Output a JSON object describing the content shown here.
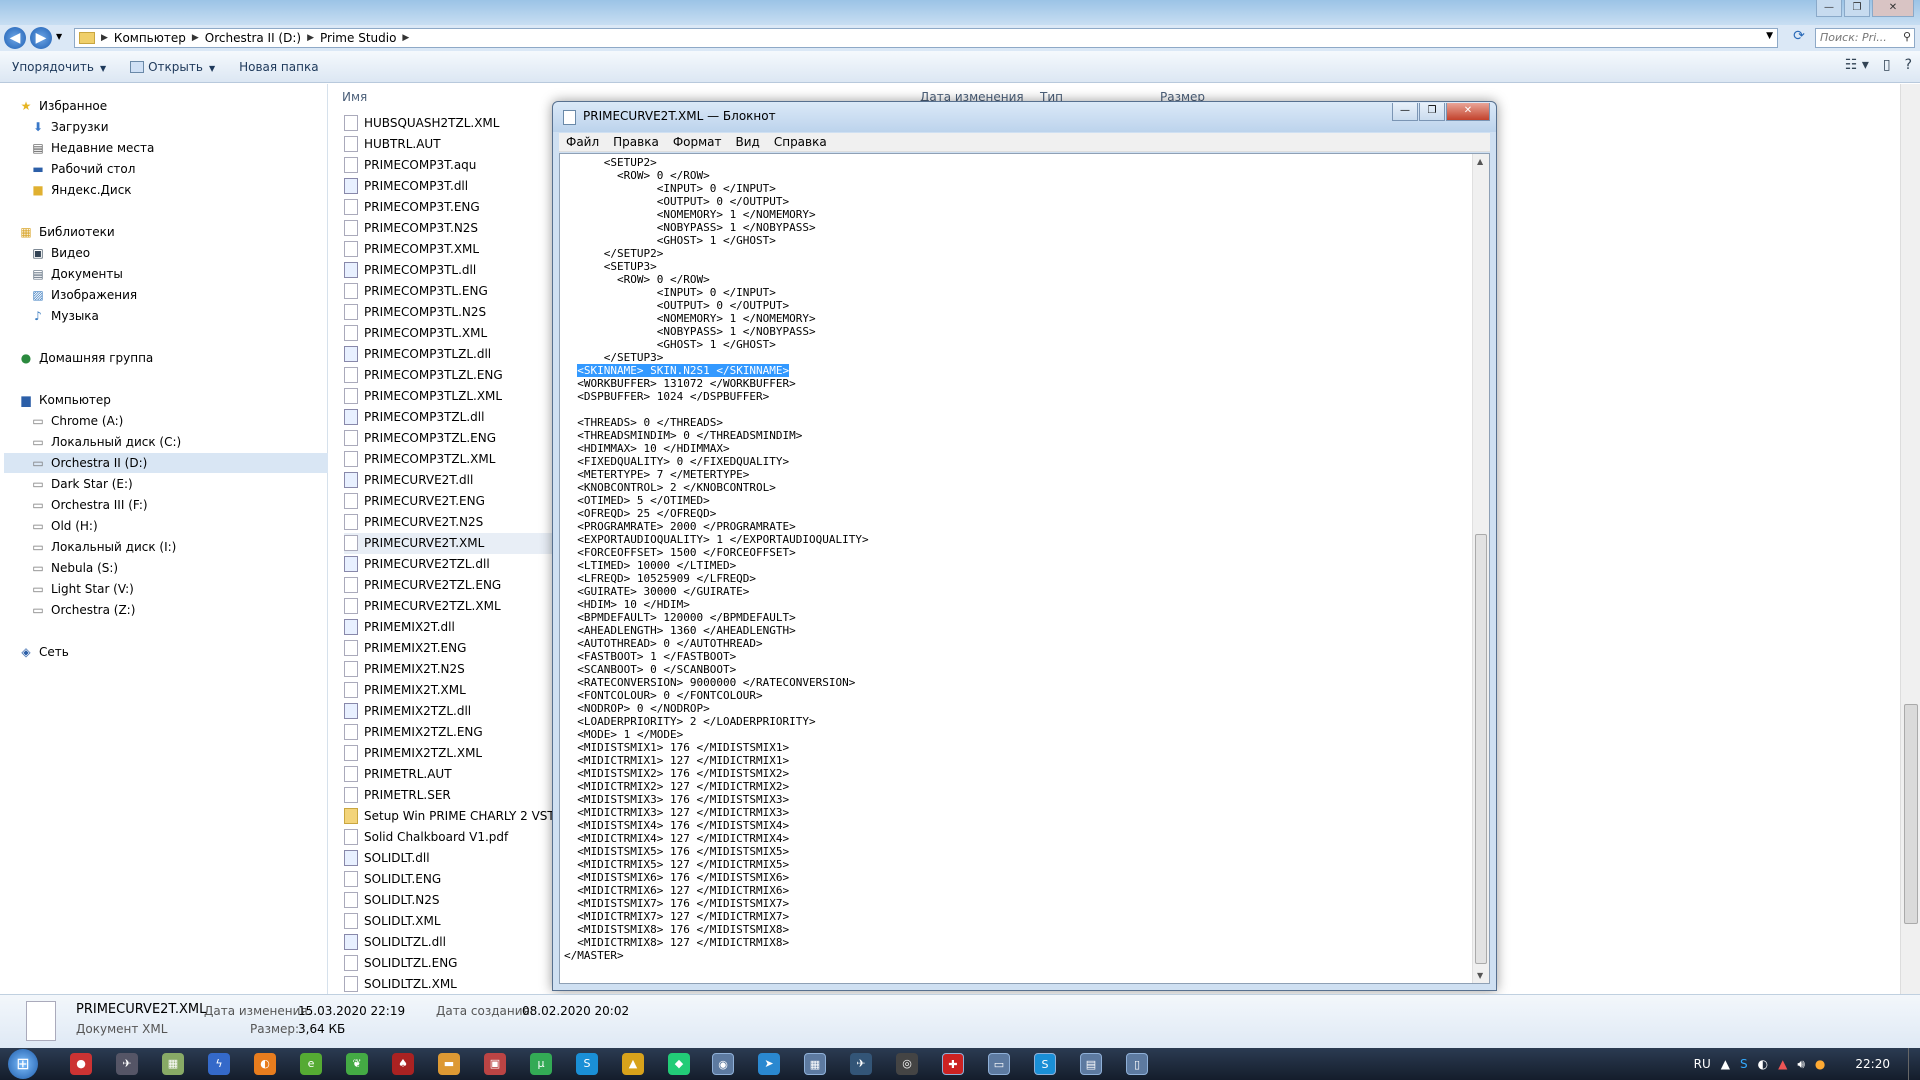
{
  "explorer": {
    "breadcrumb": [
      "Компьютер",
      "Orchestra II (D:)",
      "Prime Studio"
    ],
    "search_placeholder": "Поиск: Pri...",
    "toolbar": {
      "organize": "Упорядочить",
      "open": "Открыть",
      "new_folder": "Новая папка"
    },
    "columns": {
      "name": "Имя",
      "date": "Дата изменения",
      "type": "Тип",
      "size": "Размер"
    },
    "nav": {
      "favorites": "Избранное",
      "favorites_items": [
        "Загрузки",
        "Недавние места",
        "Рабочий стол",
        "Яндекс.Диск"
      ],
      "libraries": "Библиотеки",
      "libraries_items": [
        "Видео",
        "Документы",
        "Изображения",
        "Музыка"
      ],
      "homegroup": "Домашняя группа",
      "computer": "Компьютер",
      "computer_items": [
        "Chrome (A:)",
        "Локальный диск (C:)",
        "Orchestra II (D:)",
        "Dark Star (E:)",
        "Orchestra III (F:)",
        "Old (H:)",
        "Локальный диск (I:)",
        "Nebula (S:)",
        "Light Star (V:)",
        "Orchestra (Z:)"
      ],
      "network": "Сеть"
    },
    "files": [
      {
        "name": "HUBSQUASH2TZL.XML",
        "kind": "file"
      },
      {
        "name": "HUBTRL.AUT",
        "kind": "file"
      },
      {
        "name": "PRIMECOMP3T.aqu",
        "kind": "file"
      },
      {
        "name": "PRIMECOMP3T.dll",
        "kind": "dll"
      },
      {
        "name": "PRIMECOMP3T.ENG",
        "kind": "file"
      },
      {
        "name": "PRIMECOMP3T.N2S",
        "kind": "file"
      },
      {
        "name": "PRIMECOMP3T.XML",
        "kind": "file"
      },
      {
        "name": "PRIMECOMP3TL.dll",
        "kind": "dll"
      },
      {
        "name": "PRIMECOMP3TL.ENG",
        "kind": "file"
      },
      {
        "name": "PRIMECOMP3TL.N2S",
        "kind": "file"
      },
      {
        "name": "PRIMECOMP3TL.XML",
        "kind": "file"
      },
      {
        "name": "PRIMECOMP3TLZL.dll",
        "kind": "dll"
      },
      {
        "name": "PRIMECOMP3TLZL.ENG",
        "kind": "file"
      },
      {
        "name": "PRIMECOMP3TLZL.XML",
        "kind": "file"
      },
      {
        "name": "PRIMECOMP3TZL.dll",
        "kind": "dll"
      },
      {
        "name": "PRIMECOMP3TZL.ENG",
        "kind": "file"
      },
      {
        "name": "PRIMECOMP3TZL.XML",
        "kind": "file"
      },
      {
        "name": "PRIMECURVE2T.dll",
        "kind": "dll"
      },
      {
        "name": "PRIMECURVE2T.ENG",
        "kind": "file"
      },
      {
        "name": "PRIMECURVE2T.N2S",
        "kind": "file"
      },
      {
        "name": "PRIMECURVE2T.XML",
        "kind": "file"
      },
      {
        "name": "PRIMECURVE2TZL.dll",
        "kind": "dll"
      },
      {
        "name": "PRIMECURVE2TZL.ENG",
        "kind": "file"
      },
      {
        "name": "PRIMECURVE2TZL.XML",
        "kind": "file"
      },
      {
        "name": "PRIMEMIX2T.dll",
        "kind": "dll"
      },
      {
        "name": "PRIMEMIX2T.ENG",
        "kind": "file"
      },
      {
        "name": "PRIMEMIX2T.N2S",
        "kind": "file"
      },
      {
        "name": "PRIMEMIX2T.XML",
        "kind": "file"
      },
      {
        "name": "PRIMEMIX2TZL.dll",
        "kind": "dll"
      },
      {
        "name": "PRIMEMIX2TZL.ENG",
        "kind": "file"
      },
      {
        "name": "PRIMEMIX2TZL.XML",
        "kind": "file"
      },
      {
        "name": "PRIMETRL.AUT",
        "kind": "file"
      },
      {
        "name": "PRIMETRL.SER",
        "kind": "file"
      },
      {
        "name": "Setup Win PRIME CHARLY 2 VST 1_4",
        "kind": "folder"
      },
      {
        "name": "Solid Chalkboard V1.pdf",
        "kind": "file"
      },
      {
        "name": "SOLIDLT.dll",
        "kind": "dll"
      },
      {
        "name": "SOLIDLT.ENG",
        "kind": "file"
      },
      {
        "name": "SOLIDLT.N2S",
        "kind": "file"
      },
      {
        "name": "SOLIDLT.XML",
        "kind": "file"
      },
      {
        "name": "SOLIDLTZL.dll",
        "kind": "dll"
      },
      {
        "name": "SOLIDLTZL.ENG",
        "kind": "file"
      },
      {
        "name": "SOLIDLTZL.XML",
        "kind": "file"
      }
    ],
    "selected_file": "PRIMECURVE2T.XML",
    "details": {
      "name": "PRIMECURVE2T.XML",
      "type": "Документ XML",
      "modified_label": "Дата изменения:",
      "modified": "15.03.2020 22:19",
      "size_label": "Размер:",
      "size": "3,64 КБ",
      "created_label": "Дата создания:",
      "created": "08.02.2020 20:02"
    }
  },
  "notepad": {
    "title": "PRIMECURVE2T.XML — Блокнот",
    "menu": [
      "Файл",
      "Правка",
      "Формат",
      "Вид",
      "Справка"
    ],
    "lines": [
      "      <SETUP2>",
      "        <ROW> 0 </ROW>",
      "              <INPUT> 0 </INPUT>",
      "              <OUTPUT> 0 </OUTPUT>",
      "              <NOMEMORY> 1 </NOMEMORY>",
      "              <NOBYPASS> 1 </NOBYPASS>",
      "              <GHOST> 1 </GHOST>",
      "      </SETUP2>",
      "      <SETUP3>",
      "        <ROW> 0 </ROW>",
      "              <INPUT> 0 </INPUT>",
      "              <OUTPUT> 0 </OUTPUT>",
      "              <NOMEMORY> 1 </NOMEMORY>",
      "              <NOBYPASS> 1 </NOBYPASS>",
      "              <GHOST> 1 </GHOST>",
      "      </SETUP3>",
      "  <SKINNAME> SKIN.N2S1 </SKINNAME>",
      "  <WORKBUFFER> 131072 </WORKBUFFER>",
      "  <DSPBUFFER> 1024 </DSPBUFFER>",
      "",
      "  <THREADS> 0 </THREADS>",
      "  <THREADSMINDIM> 0 </THREADSMINDIM>",
      "  <HDIMMAX> 10 </HDIMMAX>",
      "  <FIXEDQUALITY> 0 </FIXEDQUALITY>",
      "  <METERTYPE> 7 </METERTYPE>",
      "  <KNOBCONTROL> 2 </KNOBCONTROL>",
      "  <OTIMED> 5 </OTIMED>",
      "  <OFREQD> 25 </OFREQD>",
      "  <PROGRAMRATE> 2000 </PROGRAMRATE>",
      "  <EXPORTAUDIOQUALITY> 1 </EXPORTAUDIOQUALITY>",
      "  <FORCEOFFSET> 1500 </FORCEOFFSET>",
      "  <LTIMED> 10000 </LTIMED>",
      "  <LFREQD> 10525909 </LFREQD>",
      "  <GUIRATE> 30000 </GUIRATE>",
      "  <HDIM> 10 </HDIM>",
      "  <BPMDEFAULT> 120000 </BPMDEFAULT>",
      "  <AHEADLENGTH> 1360 </AHEADLENGTH>",
      "  <AUTOTHREAD> 0 </AUTOTHREAD>",
      "  <FASTBOOT> 1 </FASTBOOT>",
      "  <SCANBOOT> 0 </SCANBOOT>",
      "  <RATECONVERSION> 9000000 </RATECONVERSION>",
      "  <FONTCOLOUR> 0 </FONTCOLOUR>",
      "  <NODROP> 0 </NODROP>",
      "  <LOADERPRIORITY> 2 </LOADERPRIORITY>",
      "  <MODE> 1 </MODE>",
      "  <MIDISTSMIX1> 176 </MIDISTSMIX1>",
      "  <MIDICTRMIX1> 127 </MIDICTRMIX1>",
      "  <MIDISTSMIX2> 176 </MIDISTSMIX2>",
      "  <MIDICTRMIX2> 127 </MIDICTRMIX2>",
      "  <MIDISTSMIX3> 176 </MIDISTSMIX3>",
      "  <MIDICTRMIX3> 127 </MIDICTRMIX3>",
      "  <MIDISTSMIX4> 176 </MIDISTSMIX4>",
      "  <MIDICTRMIX4> 127 </MIDICTRMIX4>",
      "  <MIDISTSMIX5> 176 </MIDISTSMIX5>",
      "  <MIDICTRMIX5> 127 </MIDICTRMIX5>",
      "  <MIDISTSMIX6> 176 </MIDISTSMIX6>",
      "  <MIDICTRMIX6> 127 </MIDICTRMIX6>",
      "  <MIDISTSMIX7> 176 </MIDISTSMIX7>",
      "  <MIDICTRMIX7> 127 </MIDICTRMIX7>",
      "  <MIDISTSMIX8> 176 </MIDISTSMIX8>",
      "  <MIDICTRMIX8> 127 </MIDICTRMIX8>",
      "</MASTER>"
    ],
    "selected_text": "<SKINNAME> SKIN.N2S1 </SKINNAME>",
    "selection_color": "#3399ff"
  },
  "taskbar": {
    "lang": "RU",
    "clock": "22:20"
  }
}
